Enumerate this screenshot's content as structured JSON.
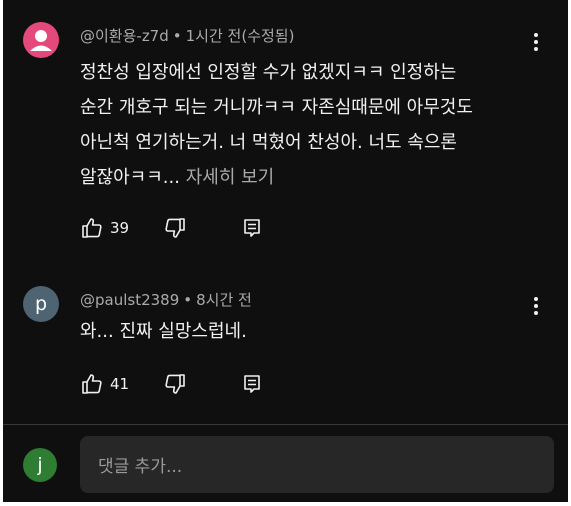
{
  "comments": [
    {
      "avatar_letter": "",
      "avatar_color": "#e3497a",
      "author": "@이환용-z7d",
      "time": "1시간 전(수정됨)",
      "lines": [
        "정찬성 입장에선 인정할 수가 없겠지ㅋㅋ 인정하는",
        "순간 개호구 되는 거니까ㅋㅋ 자존심때문에 아무것도",
        "아닌척 연기하는거. 너 먹혔어 찬성아. 너도 속으론",
        "알잖아ㅋㅋ..."
      ],
      "read_more": "자세히 보기",
      "likes": "39"
    },
    {
      "avatar_letter": "p",
      "avatar_color": "#4f6473",
      "author": "@paulst2389",
      "time": "8시간 전",
      "lines": [
        "와... 진짜 실망스럽네."
      ],
      "likes": "41"
    }
  ],
  "add_comment": {
    "avatar_letter": "j",
    "avatar_color": "#2e7d32",
    "placeholder": "댓글 추가..."
  },
  "separator": "•",
  "icons": {
    "like": "thumbs-up-icon",
    "dislike": "thumbs-down-icon",
    "reply": "reply-icon",
    "menu": "more-vert-icon"
  }
}
